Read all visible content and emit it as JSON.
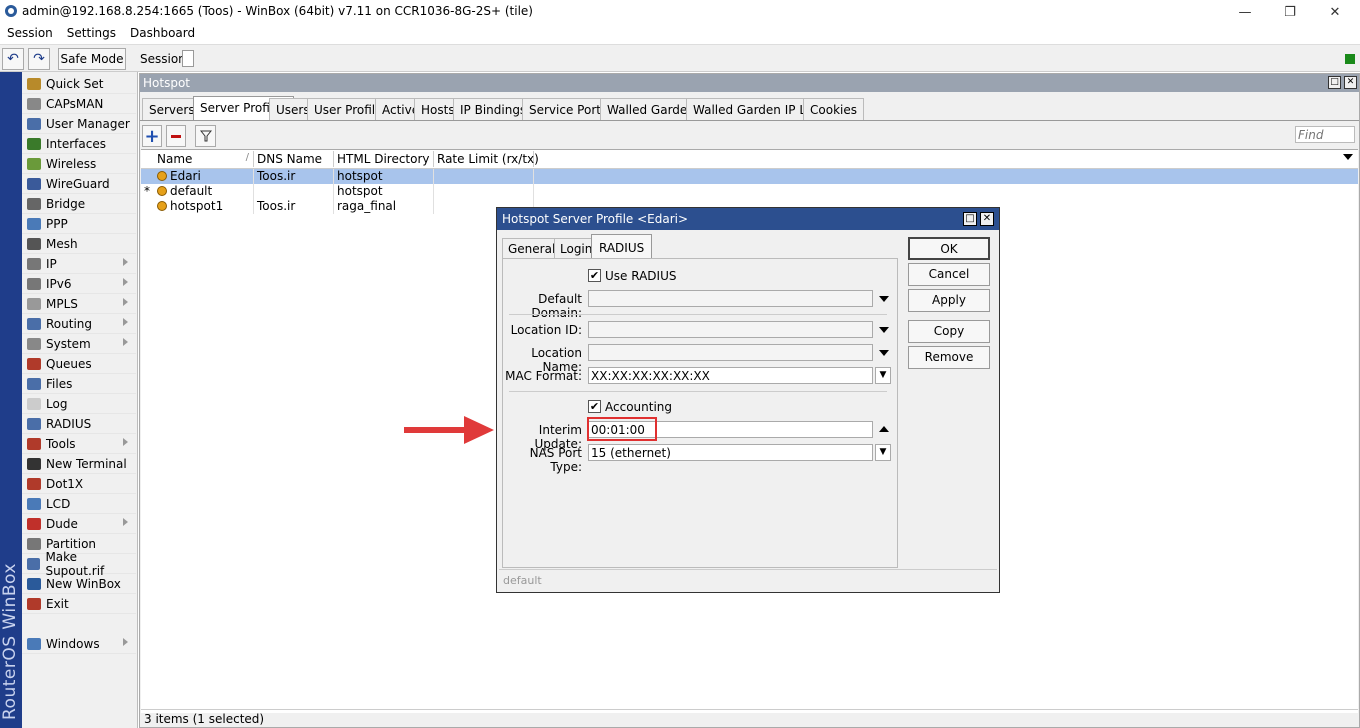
{
  "app": {
    "title": "admin@192.168.8.254:1665 (Toos) - WinBox (64bit) v7.11 on CCR1036-8G-2S+ (tile)",
    "minimize": "—",
    "maximize": "❐",
    "close": "✕"
  },
  "menu": [
    "Session",
    "Settings",
    "Dashboard"
  ],
  "toolbar": {
    "undo": "↶",
    "redo": "↷",
    "safe_mode": "Safe Mode",
    "session_label": "Session:"
  },
  "sidebar": {
    "brand": "RouterOS WinBox",
    "items": [
      {
        "label": "Quick Set",
        "icon": "wand-icon",
        "color": "#b88a2a",
        "arrow": false
      },
      {
        "label": "CAPsMAN",
        "icon": "antenna-icon",
        "color": "#888",
        "arrow": false
      },
      {
        "label": "User Manager",
        "icon": "user-icon",
        "color": "#4a6ea8",
        "arrow": false
      },
      {
        "label": "Interfaces",
        "icon": "interfaces-icon",
        "color": "#3a7a2a",
        "arrow": false
      },
      {
        "label": "Wireless",
        "icon": "wireless-icon",
        "color": "#6a9a3a",
        "arrow": false
      },
      {
        "label": "WireGuard",
        "icon": "wireguard-icon",
        "color": "#3a5a9a",
        "arrow": false
      },
      {
        "label": "Bridge",
        "icon": "bridge-icon",
        "color": "#666",
        "arrow": false
      },
      {
        "label": "PPP",
        "icon": "ppp-icon",
        "color": "#4a7ab8",
        "arrow": false
      },
      {
        "label": "Mesh",
        "icon": "mesh-icon",
        "color": "#555",
        "arrow": false
      },
      {
        "label": "IP",
        "icon": "ip-icon",
        "color": "#777",
        "arrow": true
      },
      {
        "label": "IPv6",
        "icon": "ipv6-icon",
        "color": "#777",
        "arrow": true
      },
      {
        "label": "MPLS",
        "icon": "mpls-icon",
        "color": "#999",
        "arrow": true
      },
      {
        "label": "Routing",
        "icon": "routing-icon",
        "color": "#4a6ea8",
        "arrow": true
      },
      {
        "label": "System",
        "icon": "system-icon",
        "color": "#888",
        "arrow": true
      },
      {
        "label": "Queues",
        "icon": "queues-icon",
        "color": "#b03a2a",
        "arrow": false
      },
      {
        "label": "Files",
        "icon": "files-icon",
        "color": "#4a6ea8",
        "arrow": false
      },
      {
        "label": "Log",
        "icon": "log-icon",
        "color": "#ccc",
        "arrow": false
      },
      {
        "label": "RADIUS",
        "icon": "radius-icon",
        "color": "#4a6ea8",
        "arrow": false
      },
      {
        "label": "Tools",
        "icon": "tools-icon",
        "color": "#b03a2a",
        "arrow": true
      },
      {
        "label": "New Terminal",
        "icon": "terminal-icon",
        "color": "#333",
        "arrow": false
      },
      {
        "label": "Dot1X",
        "icon": "dot1x-icon",
        "color": "#b03a2a",
        "arrow": false
      },
      {
        "label": "LCD",
        "icon": "lcd-icon",
        "color": "#4a7ab8",
        "arrow": false
      },
      {
        "label": "Dude",
        "icon": "dude-icon",
        "color": "#c0302a",
        "arrow": true
      },
      {
        "label": "Partition",
        "icon": "partition-icon",
        "color": "#777",
        "arrow": false
      },
      {
        "label": "Make Supout.rif",
        "icon": "supout-icon",
        "color": "#4a6ea8",
        "arrow": false
      },
      {
        "label": "New WinBox",
        "icon": "winbox-icon",
        "color": "#2a5a9a",
        "arrow": false
      },
      {
        "label": "Exit",
        "icon": "exit-icon",
        "color": "#b03a2a",
        "arrow": false
      }
    ],
    "windows_item": {
      "label": "Windows",
      "icon": "windows-icon",
      "color": "#4a7ab8",
      "arrow": true
    }
  },
  "hotspot": {
    "title": "Hotspot",
    "tabs": [
      "Servers",
      "Server Profiles",
      "Users",
      "User Profiles",
      "Active",
      "Hosts",
      "IP Bindings",
      "Service Ports",
      "Walled Garden",
      "Walled Garden IP List",
      "Cookies"
    ],
    "active_tab": 1,
    "find_placeholder": "Find",
    "columns": [
      "Name",
      "DNS Name",
      "HTML Directory",
      "Rate Limit (rx/tx)"
    ],
    "rows": [
      {
        "flag": "",
        "name": "Edari",
        "dns": "Toos.ir",
        "html": "hotspot",
        "rate": "",
        "selected": true
      },
      {
        "flag": "*",
        "name": "default",
        "dns": "",
        "html": "hotspot",
        "rate": "",
        "selected": false
      },
      {
        "flag": "",
        "name": "hotspot1",
        "dns": "Toos.ir",
        "html": "raga_final",
        "rate": "",
        "selected": false
      }
    ],
    "status": "3 items (1 selected)"
  },
  "dialog": {
    "title": "Hotspot Server Profile <Edari>",
    "tabs": [
      "General",
      "Login",
      "RADIUS"
    ],
    "active_tab": 2,
    "use_radius_label": "Use RADIUS",
    "use_radius_checked": true,
    "default_domain_label": "Default Domain:",
    "default_domain_value": "",
    "location_id_label": "Location ID:",
    "location_id_value": "",
    "location_name_label": "Location Name:",
    "location_name_value": "",
    "mac_format_label": "MAC Format:",
    "mac_format_value": "XX:XX:XX:XX:XX:XX",
    "accounting_label": "Accounting",
    "accounting_checked": true,
    "interim_update_label": "Interim Update:",
    "interim_update_value": "00:01:00",
    "nas_port_type_label": "NAS Port Type:",
    "nas_port_type_value": "15 (ethernet)",
    "buttons": {
      "ok": "OK",
      "cancel": "Cancel",
      "apply": "Apply",
      "copy": "Copy",
      "remove": "Remove"
    },
    "status": "default"
  },
  "colors": {
    "selected_row": "#a8c4ec",
    "highlight_box": "#e03030",
    "arrow": "#e03a3a",
    "title_bar": "#2c4f8f",
    "side_bar": "#1f3d8a"
  }
}
